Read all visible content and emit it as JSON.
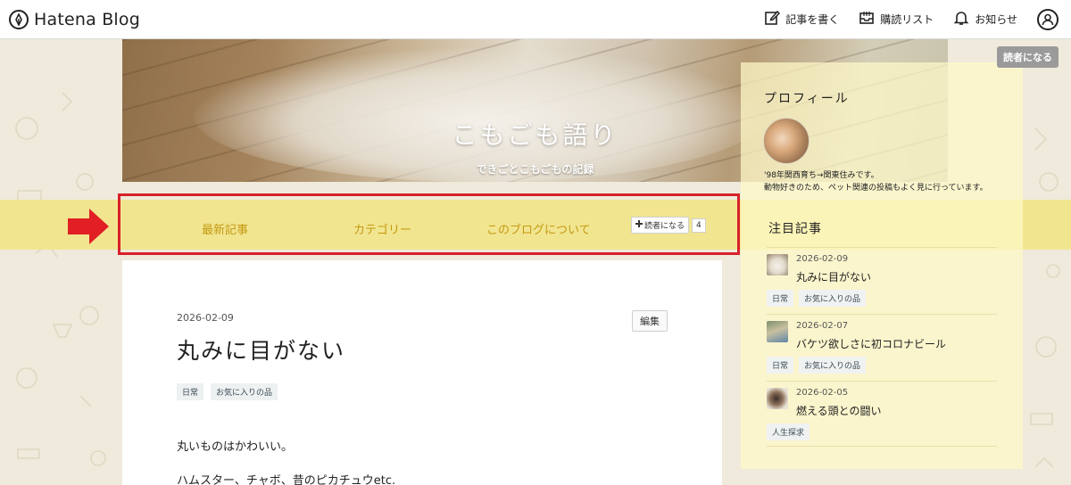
{
  "topbar": {
    "brand": "Hatena Blog",
    "nav": [
      {
        "label": "記事を書く",
        "icon": "pencil-icon"
      },
      {
        "label": "購読リスト",
        "icon": "inbox-icon"
      },
      {
        "label": "お知らせ",
        "icon": "bell-icon"
      }
    ],
    "account_icon": "user-icon"
  },
  "reader_button": "読者になる",
  "header": {
    "title": "こもごも語り",
    "subtitle": "できごとこもごもの記録"
  },
  "nav": {
    "items": [
      "最新記事",
      "カテゴリー",
      "このブログについて"
    ],
    "reader_label": "読者になる",
    "reader_count": "4",
    "highlight_color": "#d8212a"
  },
  "article": {
    "date": "2026-02-09",
    "edit_label": "編集",
    "title": "丸みに目がない",
    "tags": [
      "日常",
      "お気に入りの品"
    ],
    "paragraphs": [
      "丸いものはかわいい。",
      "ハムスター、チャボ、昔のピカチュウetc."
    ]
  },
  "sidebar": {
    "profile_heading": "プロフィール",
    "profile_lines": [
      "'98年関西育ち→関東住みです。",
      "動物好きのため、ペット関連の投稿もよく見に行っています。"
    ],
    "featured_heading": "注目記事",
    "featured": [
      {
        "date": "2026-02-09",
        "title": "丸みに目がない",
        "tags": [
          "日常",
          "お気に入りの品"
        ]
      },
      {
        "date": "2026-02-07",
        "title": "バケツ欲しさに初コロナビール",
        "tags": [
          "日常",
          "お気に入りの品"
        ]
      },
      {
        "date": "2026-02-05",
        "title": "燃える頭との闘い",
        "tags": [
          "人生探求"
        ]
      }
    ]
  },
  "colors": {
    "nav_band": "#f1e590",
    "nav_text": "#c59a12",
    "page_bg": "#efeadb"
  }
}
